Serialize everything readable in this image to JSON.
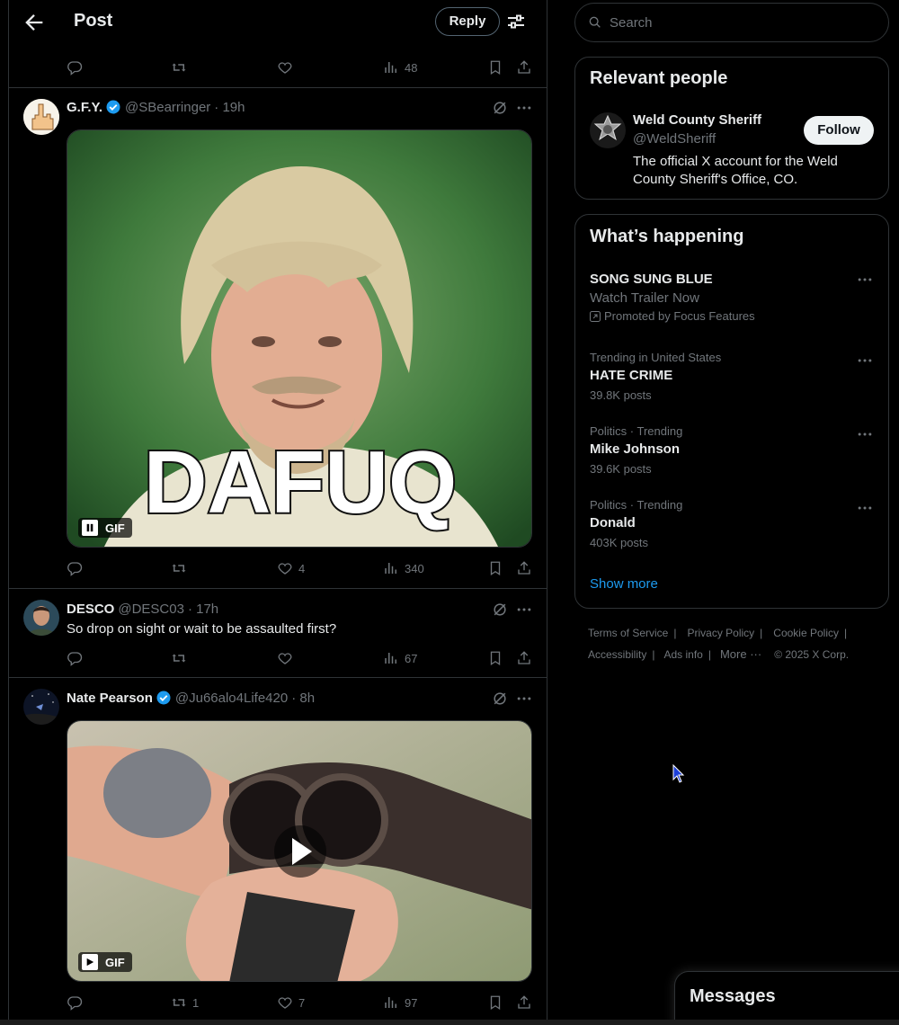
{
  "header": {
    "title": "Post",
    "reply_label": "Reply"
  },
  "top_actions": {
    "views": "48"
  },
  "posts": [
    {
      "name": "G.F.Y.",
      "handle": "@SBearringer",
      "time": "· 19h",
      "verified": true,
      "media_type": "GIF",
      "media_caption": "DAFUQ",
      "likes": "4",
      "views": "340"
    },
    {
      "name": "DESCO",
      "handle": "@DESC03",
      "time": "· 17h",
      "verified": false,
      "text": "So drop on sight or wait to be assaulted first?",
      "views": "67"
    },
    {
      "name": "Nate Pearson",
      "handle": "@Ju66alo4Life420",
      "time": "· 8h",
      "verified": true,
      "media_type": "GIF",
      "reposts": "1",
      "likes": "7",
      "views": "97"
    }
  ],
  "search": {
    "placeholder": "Search"
  },
  "relevant_people": {
    "title": "Relevant people",
    "name": "Weld County Sheriff",
    "handle": "@WeldSheriff",
    "bio": "The official X account for the Weld County Sheriff's Office, CO.",
    "follow_label": "Follow"
  },
  "whats_happening": {
    "title": "What’s happening",
    "promoted": {
      "title": "SONG SUNG BLUE",
      "subtitle": "Watch Trailer Now",
      "promoted_by": "Promoted by Focus Features"
    },
    "trends": [
      {
        "meta": "Trending in United States",
        "title": "HATE CRIME",
        "count": "39.8K posts"
      },
      {
        "meta": "Politics · Trending",
        "title": "Mike Johnson",
        "count": "39.6K posts"
      },
      {
        "meta": "Politics · Trending",
        "title": "Donald",
        "count": "403K posts"
      }
    ],
    "show_more": "Show more"
  },
  "footer": {
    "links": [
      "Terms of Service",
      "Privacy Policy",
      "Cookie Policy",
      "Accessibility",
      "Ads info",
      "More ···"
    ],
    "copyright": "© 2025 X Corp."
  },
  "messages": {
    "title": "Messages"
  },
  "colors": {
    "background": "#000000",
    "text": "#e7e9ea",
    "muted": "#71767b",
    "border": "#2f3336",
    "accent": "#1d9bf0"
  }
}
